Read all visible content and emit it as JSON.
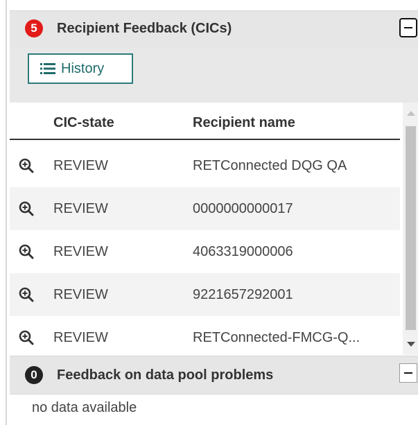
{
  "recipient_feedback": {
    "badge_count": "5",
    "title": "Recipient Feedback (CICs)",
    "history_label": "History",
    "columns": [
      "CIC-state",
      "Recipient name"
    ],
    "rows": [
      {
        "state": "REVIEW",
        "name": "RETConnected DQG QA"
      },
      {
        "state": "REVIEW",
        "name": "0000000000017"
      },
      {
        "state": "REVIEW",
        "name": "4063319000006"
      },
      {
        "state": "REVIEW",
        "name": "9221657292001"
      },
      {
        "state": "REVIEW",
        "name": "RETConnected-FMCG-Q..."
      }
    ]
  },
  "data_pool_feedback": {
    "badge_count": "0",
    "title": "Feedback on data pool problems",
    "empty_text": "no data available"
  },
  "colors": {
    "badge_red": "#e21a1a",
    "badge_dark": "#222222",
    "accent_teal": "#2c7a7a"
  },
  "icons": {
    "history": "list-icon",
    "row_action": "zoom-in-icon",
    "collapse": "minus-icon"
  }
}
